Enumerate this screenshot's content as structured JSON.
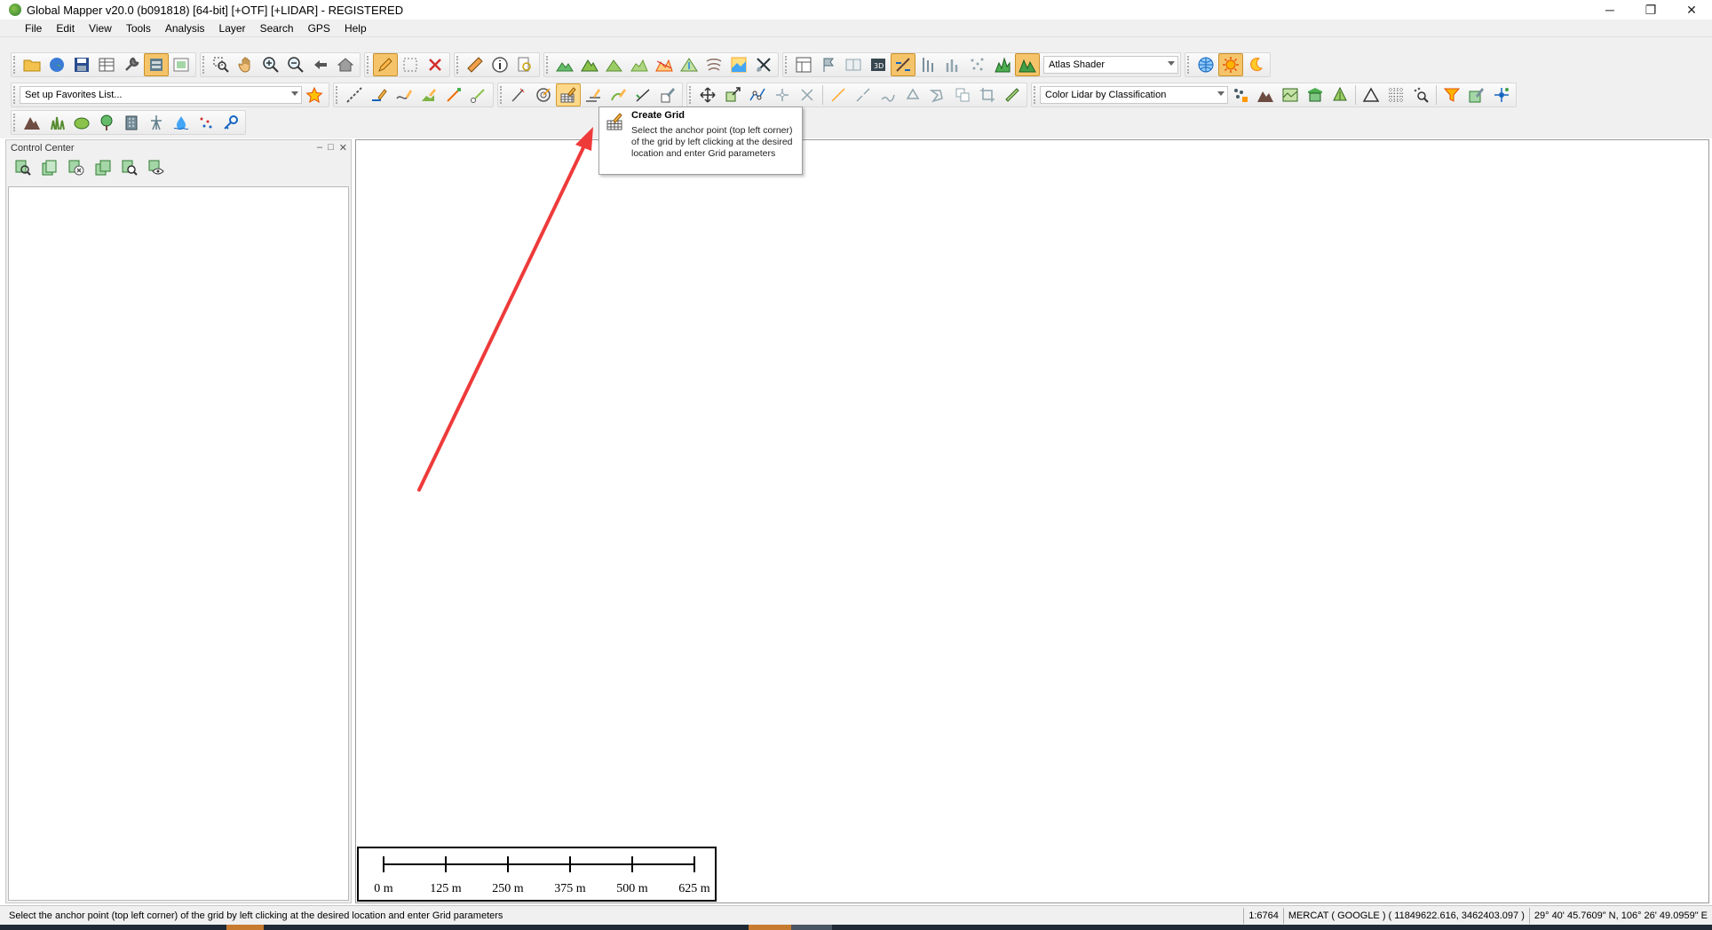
{
  "window": {
    "title": "Global Mapper v20.0 (b091818) [64-bit] [+OTF] [+LIDAR] - REGISTERED",
    "minimize": "─",
    "restore": "❐",
    "close": "✕"
  },
  "menu": [
    "File",
    "Edit",
    "View",
    "Tools",
    "Analysis",
    "Layer",
    "Search",
    "GPS",
    "Help"
  ],
  "toolbar": {
    "shader_select": "Atlas Shader",
    "favorites_select": "Set up Favorites List...",
    "lidar_select": "Color Lidar by Classification"
  },
  "tooltip": {
    "title": "Create Grid",
    "body": "Select the anchor point (top left corner) of the grid by left clicking at the desired location and enter Grid parameters"
  },
  "control_center": {
    "title": "Control Center",
    "minimize": "–",
    "maximize": "□",
    "close": "✕"
  },
  "scalebar": {
    "labels": [
      "0 m",
      "125 m",
      "250 m",
      "375 m",
      "500 m",
      "625 m"
    ]
  },
  "status": {
    "message": "Select the anchor point (top left corner) of the grid by left clicking at the desired location and enter Grid parameters",
    "scale": "1:6764",
    "projection": "MERCAT ( GOOGLE ) ( 11849622.616, 3462403.097 )",
    "coords": "29° 40' 45.7609\" N, 106° 26' 49.0959\" E"
  },
  "colors": {
    "arrow": "#ef3a3a",
    "active_tool": "#f5c46a"
  }
}
